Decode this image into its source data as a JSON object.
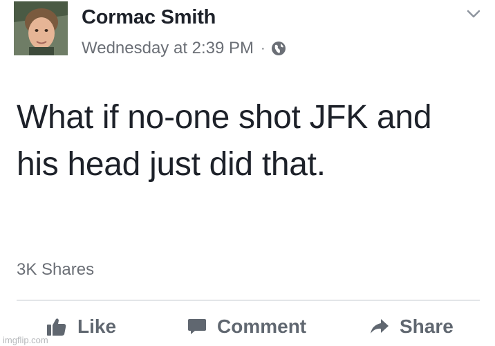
{
  "post": {
    "author_name": "Cormac Smith",
    "timestamp": "Wednesday at 2:39 PM",
    "separator": "·",
    "privacy_icon": "globe-icon",
    "menu_icon": "chevron-down-icon",
    "text": "What if no-one shot JFK and his head just did that.",
    "shares": "3K Shares"
  },
  "actions": {
    "like_label": "Like",
    "like_icon": "thumbs-up-icon",
    "comment_label": "Comment",
    "comment_icon": "speech-bubble-icon",
    "share_label": "Share",
    "share_icon": "share-arrow-icon"
  },
  "watermark": "imgflip.com",
  "colors": {
    "text_primary": "#1d2129",
    "text_secondary": "#6b6f76",
    "action_text": "#606770",
    "divider": "#e3e5e8"
  }
}
